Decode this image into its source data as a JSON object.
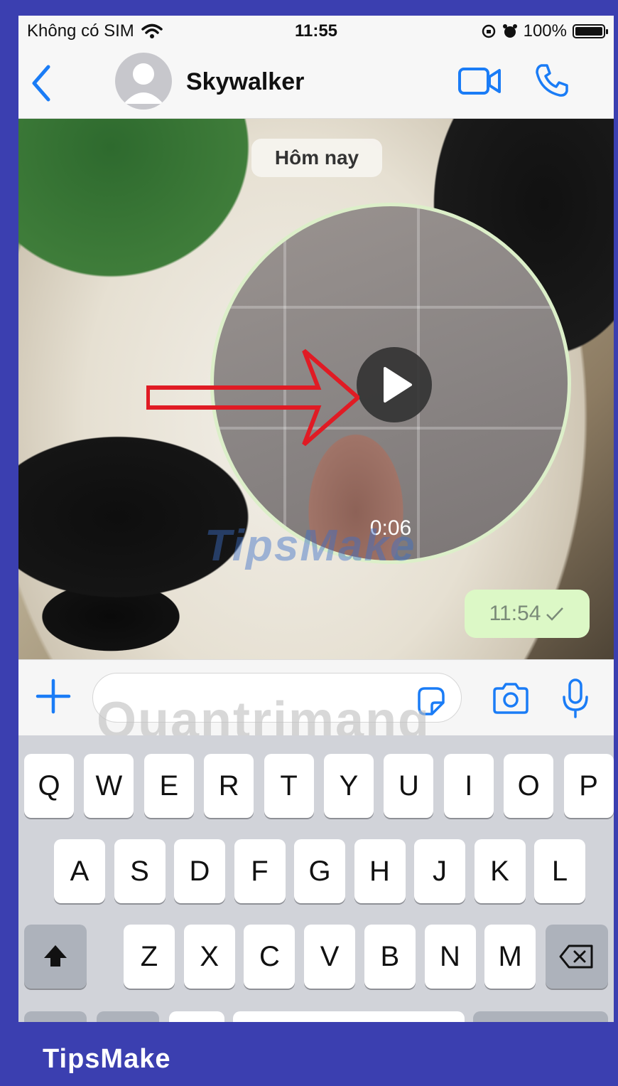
{
  "status_bar": {
    "carrier": "Không có SIM",
    "time": "11:55",
    "battery": "100%"
  },
  "header": {
    "contact_name": "Skywalker"
  },
  "chat": {
    "date_label": "Hôm nay",
    "video_duration": "0:06",
    "message_time": "11:54",
    "watermark": "TipsMake"
  },
  "input_bar": {
    "watermark": "Quantrimang"
  },
  "keyboard": {
    "row1": [
      "Q",
      "W",
      "E",
      "R",
      "T",
      "Y",
      "U",
      "I",
      "O",
      "P"
    ],
    "row2": [
      "A",
      "S",
      "D",
      "F",
      "G",
      "H",
      "J",
      "K",
      "L"
    ],
    "row3": [
      "Z",
      "X",
      "C",
      "V",
      "B",
      "N",
      "M"
    ]
  },
  "footer": {
    "brand": "TipsMake"
  },
  "colors": {
    "accent": "#1a7cf6",
    "bubble": "#dcf8c6",
    "frame": "#3b3fb0",
    "annotation_arrow": "#e01b24"
  }
}
